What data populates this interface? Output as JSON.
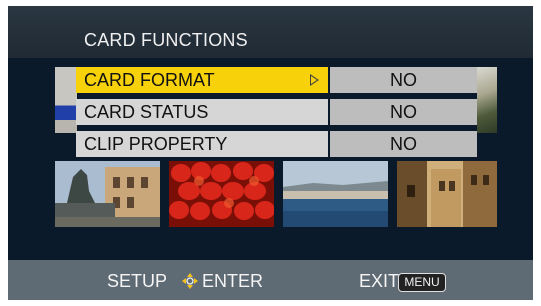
{
  "header": {
    "title": "CARD FUNCTIONS"
  },
  "menu": {
    "items": [
      {
        "label": "CARD FORMAT",
        "value": "NO",
        "selected": true
      },
      {
        "label": "CARD STATUS",
        "value": "NO",
        "selected": false
      },
      {
        "label": "CLIP PROPERTY",
        "value": "NO",
        "selected": false
      }
    ]
  },
  "footer": {
    "setup_label": "SETUP",
    "enter_label": "ENTER",
    "exit_label": "EXIT",
    "menu_badge": "MENU"
  },
  "colors": {
    "selected_highlight": "#f7d20a",
    "row_label_bg": "#d6d6d6",
    "row_value_bg": "#bdbdbd",
    "background": "#0b1a2b",
    "bottom_bar": "#5e6a74"
  },
  "icons": {
    "enter": "dpad-enter-icon",
    "arrow": "right-triangle-icon"
  }
}
